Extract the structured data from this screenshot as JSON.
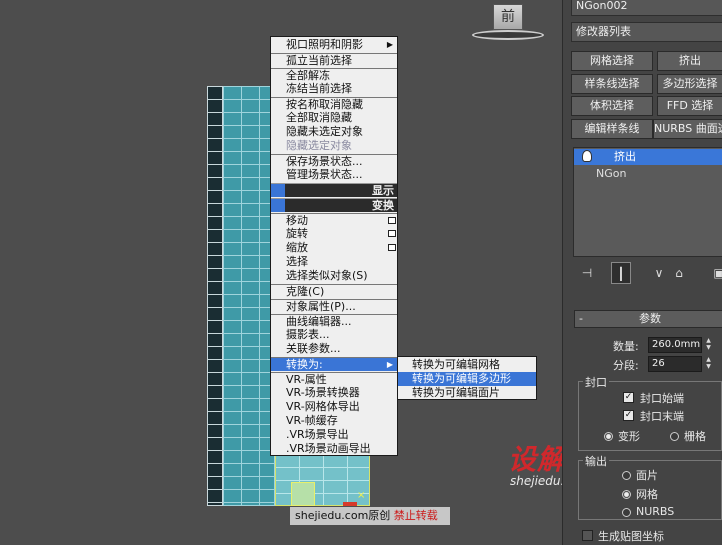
{
  "viewcube": {
    "face_label": "前"
  },
  "quad_menu": {
    "items": [
      {
        "label": "视口照明和阴影",
        "has_submenu": true
      },
      {
        "label": "孤立当前选择"
      },
      {
        "label": "全部解冻"
      },
      {
        "label": "冻结当前选择"
      },
      {
        "label": "按名称取消隐藏"
      },
      {
        "label": "全部取消隐藏"
      },
      {
        "label": "隐藏未选定对象"
      },
      {
        "label": "隐藏选定对象",
        "state": "disabled"
      },
      {
        "label": "保存场景状态..."
      },
      {
        "label": "管理场景状态..."
      }
    ],
    "header_display": "显示",
    "header_transform": "变换",
    "transform_items": [
      {
        "label": "移动",
        "has_options": true
      },
      {
        "label": "旋转",
        "has_options": true
      },
      {
        "label": "缩放",
        "has_options": true
      },
      {
        "label": "选择"
      },
      {
        "label": "选择类似对象(S)"
      },
      {
        "label": "克隆(C)"
      },
      {
        "label": "对象属性(P)..."
      },
      {
        "label": "曲线编辑器..."
      },
      {
        "label": "摄影表..."
      },
      {
        "label": "关联参数..."
      },
      {
        "label": "转换为:",
        "has_submenu": true,
        "state": "highlighted"
      },
      {
        "label": "VR-属性"
      },
      {
        "label": "VR-场景转换器"
      },
      {
        "label": "VR-网格体导出"
      },
      {
        "label": "VR-帧缓存"
      },
      {
        "label": ".VR场景导出"
      },
      {
        "label": ".VR场景动画导出"
      }
    ],
    "submenu": [
      {
        "label": "转换为可编辑网格"
      },
      {
        "label": "转换为可编辑多边形",
        "state": "highlighted"
      },
      {
        "label": "转换为可编辑面片"
      }
    ]
  },
  "watermark": {
    "site": "shejiedu.com",
    "suffix": "原创",
    "warning": "禁止转载"
  },
  "logo": {
    "brand": "设解读",
    "url": "shejiedu.com"
  },
  "command_panel": {
    "object_name": "NGon002",
    "modifier_list": "修改器列表",
    "buttons": [
      {
        "label": "网格选择"
      },
      {
        "label": "挤出"
      },
      {
        "label": "样条线选择"
      },
      {
        "label": "多边形选择"
      },
      {
        "label": "体积选择"
      },
      {
        "label": "FFD 选择"
      },
      {
        "label": "编辑样条线"
      },
      {
        "label": "NURBS 曲面选择"
      }
    ],
    "stack": {
      "modifier": "挤出",
      "base_object": "NGon"
    },
    "tools": [
      "pin-stack",
      "show-end-result",
      "make-unique",
      "remove-modifier",
      "configure-modifier-sets"
    ],
    "parameters": {
      "rollout_title": "参数",
      "amount_label": "数量:",
      "amount_value": "260.0mm",
      "segments_label": "分段:",
      "segments_value": "26",
      "capping_label": "封口",
      "cap_start": {
        "label": "封口始端",
        "checked": true
      },
      "cap_end": {
        "label": "封口末端",
        "checked": true
      },
      "morph": {
        "label": "变形",
        "selected": true
      },
      "grid": {
        "label": "栅格",
        "selected": false
      },
      "output_label": "输出",
      "output_options": [
        {
          "label": "面片",
          "selected": false
        },
        {
          "label": "网格",
          "selected": true
        },
        {
          "label": "NURBS",
          "selected": false
        }
      ],
      "gen_mapping": {
        "label": "生成贴图坐标",
        "checked": false
      }
    }
  }
}
